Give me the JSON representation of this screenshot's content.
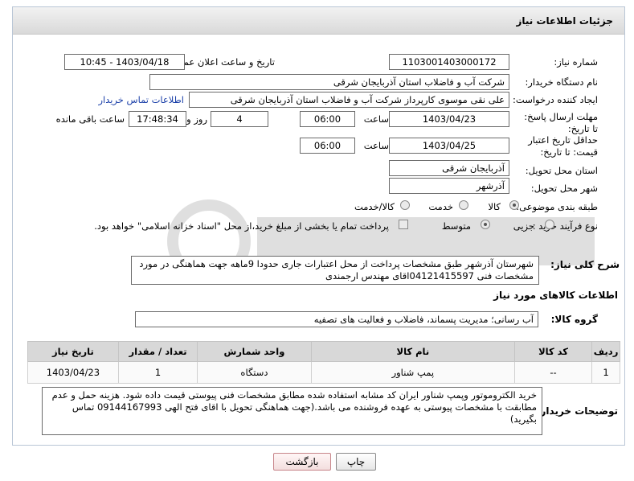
{
  "header": {
    "title": "جزئیات اطلاعات نیاز"
  },
  "form": {
    "need_number_label": "شماره نیاز:",
    "need_number": "1103001403000172",
    "announce_label": "تاریخ و ساعت اعلان عمومی:",
    "announce_value": "1403/04/18 - 10:45",
    "buyer_org_label": "نام دستگاه خریدار:",
    "buyer_org": "شرکت آب و فاضلاب استان آذربایجان شرقی",
    "requester_label": "ایجاد کننده درخواست:",
    "requester": "علی نقی موسوی کارپرداز شرکت آب و فاضلاب استان آذربایجان شرقی",
    "contact_link": "اطلاعات تماس خریدار",
    "reply_deadline_label": "مهلت ارسال پاسخ: تا تاریخ:",
    "reply_date": "1403/04/23",
    "time_label": "ساعت",
    "reply_time": "06:00",
    "days_value": "4",
    "days_label": "روز و",
    "remaining_time": "17:48:34",
    "remaining_label": "ساعت باقی مانده",
    "validity_label": "حداقل تاریخ اعتبار قیمت: تا تاریخ:",
    "validity_date": "1403/04/25",
    "validity_time": "06:00",
    "province_label": "استان محل تحویل:",
    "province": "آذربایجان شرقی",
    "city_label": "شهر محل تحویل:",
    "city": "آذرشهر",
    "category_label": "طبقه بندی موضوعی:",
    "category_options": [
      "کالا",
      "خدمت",
      "کالا/خدمت"
    ],
    "process_label": "نوع فرآیند خرید :",
    "process_options": [
      "جزیی",
      "متوسط"
    ],
    "treasury_note": "پرداخت تمام یا بخشی از مبلغ خرید،از محل \"اسناد خزانه اسلامی\" خواهد بود.",
    "description_label": "شرح کلی نیاز:",
    "description": "شهرستان آذرشهر   طبق مشخصات پرداخت از محل اعتبارات جاری حدودا 9ماهه جهت هماهنگی در مورد مشخصات فنی 04121415597اقای مهندس ارجمندی"
  },
  "goods": {
    "section_title": "اطلاعات کالاهای مورد نیاز",
    "group_label": "گروه کالا:",
    "group_value": "آب رسانی؛ مدیریت پسماند، فاضلاب و فعالیت های تصفیه",
    "columns": [
      "ردیف",
      "کد کالا",
      "نام کالا",
      "واحد شمارش",
      "تعداد / مقدار",
      "تاریخ نیاز"
    ],
    "rows": [
      {
        "index": "1",
        "code": "--",
        "name": "پمپ شناور",
        "unit": "دستگاه",
        "qty": "1",
        "date": "1403/04/23"
      }
    ]
  },
  "buyer_notes": {
    "label": "توضیحات خریدار:",
    "text": "خرید الکتروموتور وپمپ شناور      ایران کد مشابه استفاده شده مطابق مشخصات فنی پیوستی قیمت داده شود. هزینه حمل و عدم مطابقت با مشخصات پیوستی به عهده فروشنده می باشد.(جهت هماهنگی تحویل با اقای فتح الهی  09144167993 تماس بگیرید)"
  },
  "buttons": {
    "print": "چاپ",
    "back": "بازگشت"
  },
  "colors": {
    "header_bg": "#e0e0e0",
    "link": "#1a3fa8",
    "table_header": "#d8d8d8"
  }
}
